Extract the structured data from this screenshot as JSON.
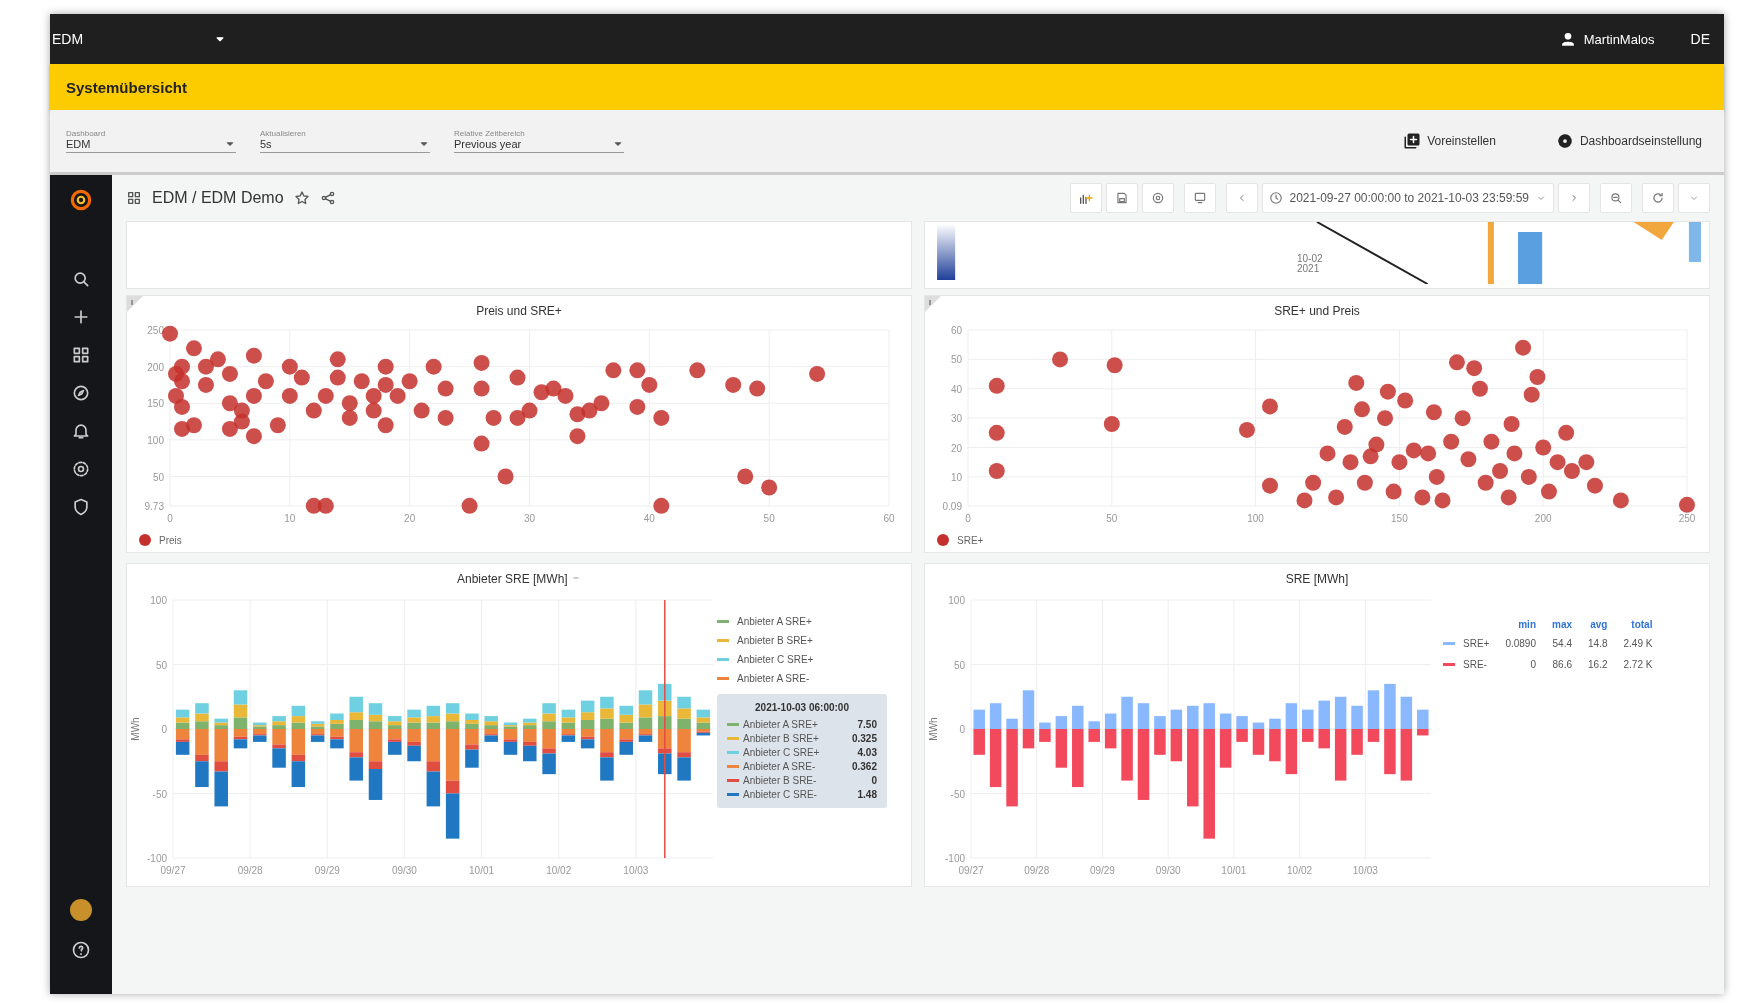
{
  "topbar": {
    "app": "EDM",
    "user": "MartinMalos",
    "language": "DE"
  },
  "banner": {
    "title": "Systemübersicht"
  },
  "filters": [
    {
      "label": "Dashboard",
      "value": "EDM"
    },
    {
      "label": "Aktualisieren",
      "value": "5s"
    },
    {
      "label": "Relative Zeitbereich",
      "value": "Previous year"
    }
  ],
  "actions": [
    {
      "kind": "preset",
      "label": "Voreinstellen"
    },
    {
      "kind": "settings",
      "label": "Dashboardseinstellung"
    }
  ],
  "dashboard": {
    "breadcrumb": "EDM / EDM Demo",
    "time_range": "2021-09-27 00:00:00 to 2021-10-03 23:59:59"
  },
  "strip": {
    "date_label": [
      "10-02",
      "2021"
    ]
  },
  "panels": [
    {
      "title": "Preis und SRE+",
      "chart_data": {
        "type": "scatter",
        "grid": true,
        "xlim": [
          0,
          60
        ],
        "ylim": [
          9.73,
          250
        ],
        "xticks": [
          0,
          10,
          20,
          30,
          40,
          50,
          60
        ],
        "yticks": [
          {
            "value": 9.73,
            "label": "9.73"
          },
          {
            "value": 50,
            "label": "50"
          },
          {
            "value": 100,
            "label": "100"
          },
          {
            "value": 150,
            "label": "150"
          },
          {
            "value": 200,
            "label": "200"
          },
          {
            "value": 250,
            "label": "250"
          }
        ],
        "x": [
          0,
          2,
          1,
          0.5,
          1,
          0.5,
          1,
          2,
          1,
          3,
          3,
          4,
          5,
          5,
          5,
          6,
          6,
          7,
          7,
          7,
          8,
          9,
          10,
          10,
          11,
          12,
          12,
          13,
          13,
          14,
          14,
          15,
          15,
          16,
          17,
          17,
          18,
          18,
          18,
          19,
          20,
          21,
          22,
          23,
          23,
          25,
          26,
          26,
          26,
          27,
          28,
          29,
          29,
          30,
          31,
          32,
          33,
          34,
          34,
          35,
          36,
          37,
          39,
          39,
          40,
          41,
          41,
          44,
          47,
          48,
          49,
          50,
          54
        ],
        "series": [
          {
            "name": "Preis",
            "color": "#c4302b",
            "values": [
              245,
              225,
              200,
              190,
              180,
              160,
              145,
              120,
              115,
              200,
              175,
              210,
              190,
              150,
              115,
              140,
              125,
              215,
              105,
              160,
              180,
              120,
              200,
              160,
              185,
              140,
              10,
              10,
              160,
              210,
              185,
              150,
              130,
              180,
              160,
              140,
              200,
              175,
              120,
              160,
              180,
              140,
              200,
              170,
              130,
              10,
              205,
              170,
              95,
              130,
              50,
              185,
              130,
              140,
              165,
              170,
              160,
              135,
              105,
              140,
              150,
              195,
              195,
              145,
              175,
              10,
              130,
              195,
              175,
              50,
              170,
              35,
              190
            ]
          }
        ]
      }
    },
    {
      "title": "SRE+ und Preis",
      "chart_data": {
        "type": "scatter",
        "grid": true,
        "xlim": [
          0,
          250
        ],
        "ylim": [
          0.09,
          60
        ],
        "xticks": [
          0,
          50,
          100,
          150,
          200,
          250
        ],
        "yticks": [
          {
            "value": 0.09,
            "label": "0.09"
          },
          {
            "value": 10,
            "label": "10"
          },
          {
            "value": 20,
            "label": "20"
          },
          {
            "value": 30,
            "label": "30"
          },
          {
            "value": 40,
            "label": "40"
          },
          {
            "value": 50,
            "label": "50"
          },
          {
            "value": 60,
            "label": "60"
          }
        ],
        "x": [
          10,
          10,
          10,
          32,
          51,
          50,
          97,
          105,
          105,
          117,
          120,
          125,
          128,
          131,
          133,
          135,
          137,
          138,
          140,
          142,
          145,
          146,
          148,
          150,
          152,
          155,
          158,
          160,
          162,
          163,
          165,
          168,
          170,
          172,
          174,
          176,
          178,
          180,
          182,
          185,
          188,
          189,
          190,
          193,
          195,
          196,
          198,
          200,
          202,
          205,
          208,
          210,
          215,
          218,
          227,
          250
        ],
        "series": [
          {
            "name": "SRE+",
            "color": "#c4302b",
            "values": [
              41,
              25,
              12,
              50,
              48,
              28,
              26,
              34,
              7,
              2,
              8,
              18,
              3,
              27,
              15,
              42,
              33,
              8,
              17,
              21,
              30,
              39,
              5,
              15,
              36,
              19,
              3,
              18,
              32,
              10,
              2,
              22,
              49,
              30,
              16,
              47,
              40,
              8,
              22,
              12,
              3,
              28,
              18,
              54,
              10,
              38,
              44,
              20,
              5,
              15,
              25,
              12,
              15,
              7,
              2,
              0.5
            ]
          }
        ]
      }
    },
    {
      "title": "Anbieter SRE [MWh]",
      "chart_data": {
        "type": "bar",
        "grid": true,
        "stacked": true,
        "ylabel": "MWh",
        "ylim": [
          -100,
          100
        ],
        "yticks": [
          -100,
          -50,
          0,
          50,
          100
        ],
        "categories": [
          "09/27",
          null,
          null,
          null,
          "09/28",
          null,
          null,
          null,
          "09/29",
          null,
          null,
          null,
          "09/30",
          null,
          null,
          null,
          "10/01",
          null,
          null,
          null,
          "10/02",
          null,
          null,
          null,
          "10/03",
          null,
          null,
          null
        ],
        "legend": "right",
        "series": [
          {
            "name": "Anbieter A SRE+",
            "color": "#7eb26d",
            "values": [
              5,
              6,
              3,
              9,
              2,
              3,
              5,
              2,
              4,
              7,
              6,
              3,
              5,
              5,
              6,
              4,
              3,
              2,
              3,
              6,
              5,
              7,
              8,
              5,
              9,
              10,
              8,
              5
            ]
          },
          {
            "name": "Anbieter B SRE+",
            "color": "#eab839",
            "values": [
              4,
              6,
              2,
              10,
              1,
              3,
              5,
              2,
              3,
              6,
              5,
              3,
              4,
              5,
              6,
              3,
              3,
              1,
              2,
              6,
              4,
              6,
              8,
              6,
              10,
              12,
              8,
              4
            ]
          },
          {
            "name": "Anbieter C SRE+",
            "color": "#6ed0e0",
            "values": [
              6,
              8,
              3,
              11,
              2,
              4,
              8,
              2,
              5,
              12,
              9,
              4,
              6,
              8,
              8,
              5,
              4,
              2,
              3,
              8,
              6,
              9,
              9,
              7,
              11,
              13,
              9,
              6
            ]
          },
          {
            "name": "Anbieter A SRE-",
            "color": "#ef843c",
            "values": [
              -8,
              -20,
              -25,
              -6,
              -4,
              -12,
              -20,
              -4,
              -6,
              -18,
              -25,
              -8,
              -10,
              -25,
              -40,
              -12,
              -4,
              -8,
              -10,
              -15,
              -4,
              -6,
              -18,
              -8,
              -4,
              -15,
              -18,
              -2
            ]
          },
          {
            "name": "Anbieter B SRE-",
            "color": "#e24d42",
            "values": [
              -2,
              -5,
              -8,
              -2,
              -1,
              -3,
              -5,
              -1,
              -2,
              -4,
              -6,
              -2,
              -3,
              -8,
              -10,
              -4,
              -1,
              -2,
              -3,
              -4,
              -1,
              -2,
              -4,
              -2,
              -1,
              -4,
              -4,
              -1
            ]
          },
          {
            "name": "Anbieter C SRE-",
            "color": "#1f78c1",
            "values": [
              -10,
              -20,
              -27,
              -7,
              -5,
              -15,
              -20,
              -5,
              -7,
              -18,
              -24,
              -10,
              -12,
              -27,
              -35,
              -14,
              -5,
              -10,
              -12,
              -16,
              -5,
              -7,
              -18,
              -10,
              -5,
              -16,
              -18,
              -2
            ]
          }
        ]
      },
      "legend": [
        "Anbieter A SRE+",
        "Anbieter B SRE+",
        "Anbieter C SRE+",
        "Anbieter A SRE-"
      ],
      "tooltip": {
        "title": "2021-10-03 06:00:00",
        "values": [
          "7.50",
          "0.325",
          "4.03",
          "0.362",
          "0",
          "1.48"
        ]
      }
    },
    {
      "title": "SRE [MWh]",
      "chart_data": {
        "type": "bar",
        "legend": "right",
        "grid": true,
        "stacked": true,
        "ylabel": "MWh",
        "ylim": [
          -100,
          100
        ],
        "yticks": [
          -100,
          -50,
          0,
          50,
          100
        ],
        "categories": [
          "09/27",
          null,
          null,
          null,
          "09/28",
          null,
          null,
          null,
          "09/29",
          null,
          null,
          null,
          "09/30",
          null,
          null,
          null,
          "10/01",
          null,
          null,
          null,
          "10/02",
          null,
          null,
          null,
          "10/03",
          null,
          null,
          null
        ],
        "series": [
          {
            "name": "SRE+",
            "color": "#8ab8ff",
            "values": [
              15,
              20,
              8,
              30,
              5,
              10,
              18,
              6,
              12,
              25,
              20,
              10,
              15,
              18,
              20,
              12,
              10,
              5,
              8,
              20,
              15,
              22,
              25,
              18,
              30,
              35,
              25,
              15
            ]
          },
          {
            "name": "SRE-",
            "color": "#f2495c",
            "values": [
              -20,
              -45,
              -60,
              -15,
              -10,
              -30,
              -45,
              -10,
              -15,
              -40,
              -55,
              -20,
              -25,
              -60,
              -85,
              -30,
              -10,
              -20,
              -25,
              -35,
              -10,
              -15,
              -40,
              -20,
              -10,
              -35,
              -40,
              -5
            ]
          }
        ]
      },
      "legend_table": {
        "columns": [
          "min",
          "max",
          "avg",
          "total"
        ],
        "rows": [
          {
            "values": [
              "0.0890",
              "54.4",
              "14.8",
              "2.49 K"
            ]
          },
          {
            "values": [
              "0",
              "86.6",
              "16.2",
              "2.72 K"
            ]
          }
        ]
      }
    }
  ]
}
